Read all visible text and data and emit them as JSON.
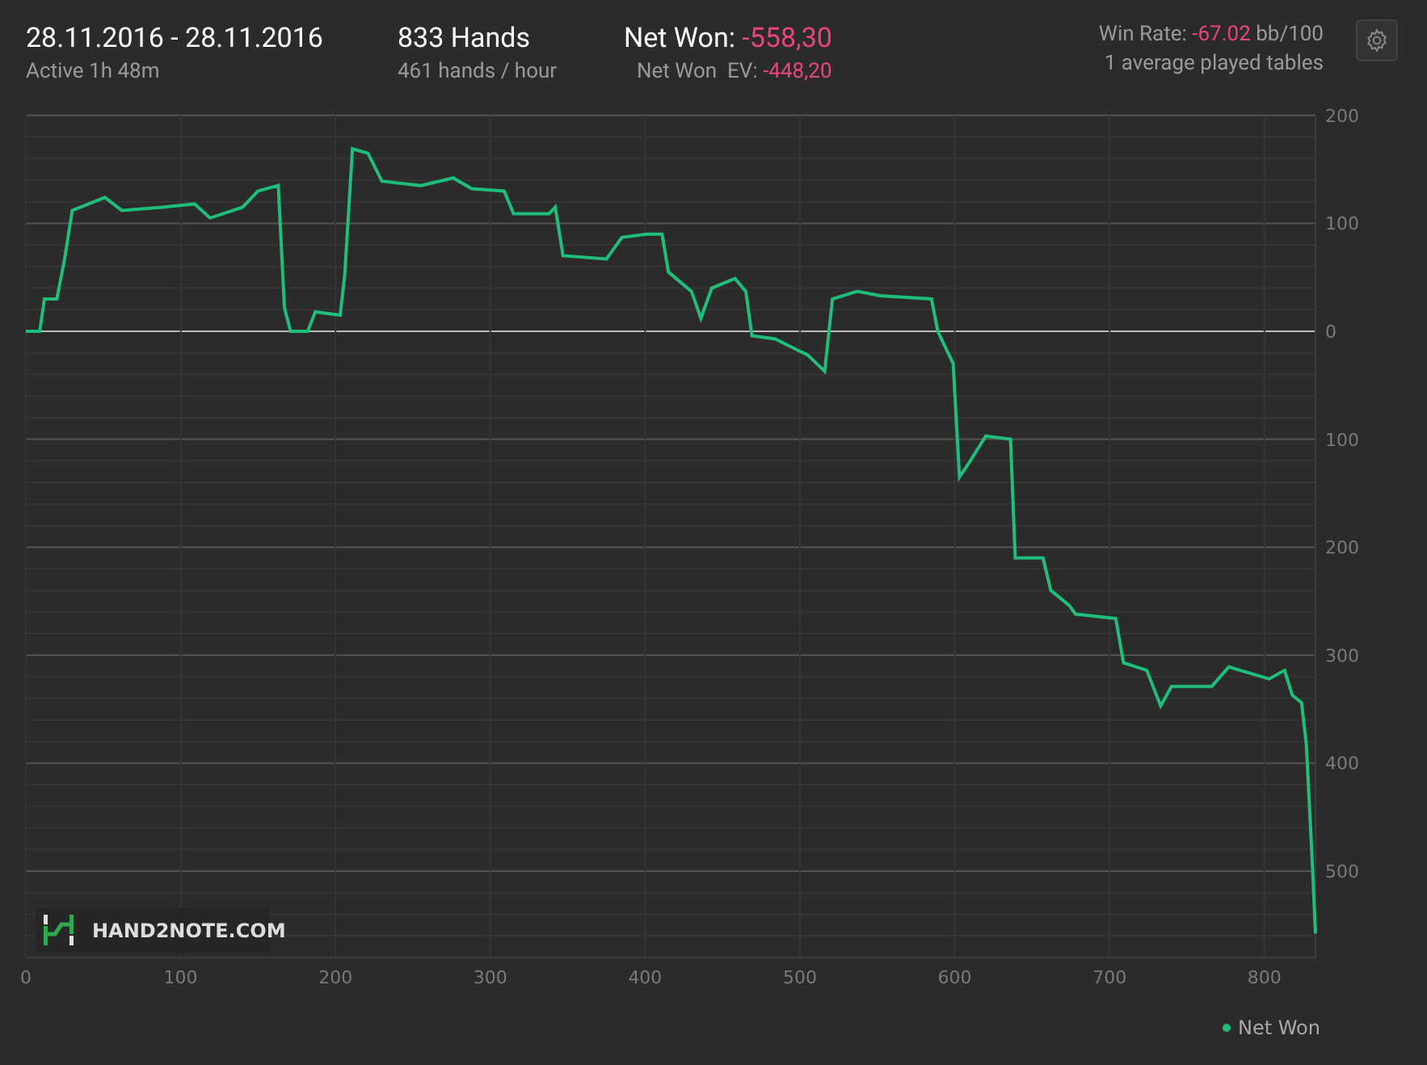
{
  "header": {
    "date_range": "28.11.2016 - 28.11.2016",
    "active": "Active 1h 48m",
    "hands": "833 Hands",
    "hands_rate": "461 hands / hour",
    "net_won": {
      "label": "Net Won:",
      "value": "-558,30"
    },
    "net_won_ev": {
      "label": "Net Won  EV:",
      "value": "-448,20"
    },
    "win_rate": {
      "label": "Win Rate:",
      "value": "-67.02",
      "unit": "bb/100"
    },
    "tables": "1 average played tables"
  },
  "chart": {
    "logo": "HAND2NOTE.COM",
    "chart_data": {
      "type": "line",
      "grid": true,
      "xlim": [
        0,
        833
      ],
      "ylim": [
        -580,
        200
      ],
      "xticks": [
        0,
        100,
        200,
        300,
        400,
        500,
        600,
        700,
        800
      ],
      "yticks": [
        {
          "value": 200,
          "label": "200"
        },
        {
          "value": 100,
          "label": "100"
        },
        {
          "value": 0,
          "label": "0"
        },
        {
          "value": -100,
          "label": "100"
        },
        {
          "value": -200,
          "label": "200"
        },
        {
          "value": -300,
          "label": "300"
        },
        {
          "value": -400,
          "label": "400"
        },
        {
          "value": -500,
          "label": "500"
        }
      ],
      "x": [
        0,
        9,
        12,
        20,
        25,
        30,
        51,
        62,
        88,
        109,
        119,
        140,
        150,
        163,
        167,
        171,
        182,
        187,
        203,
        206,
        211,
        221,
        230,
        255,
        276,
        288,
        309,
        315,
        338,
        342,
        347,
        375,
        385,
        401,
        411,
        415,
        430,
        436,
        443,
        458,
        465,
        469,
        484,
        495,
        505,
        516,
        521,
        537,
        552,
        585,
        589,
        599,
        603,
        610,
        620,
        636,
        639,
        657,
        662,
        674,
        678,
        704,
        709,
        724,
        733,
        740,
        766,
        777,
        803,
        813,
        818,
        824,
        827,
        831,
        833
      ],
      "series": [
        {
          "name": "Net Won",
          "color": "#1dbf7a",
          "values": [
            0,
            0,
            30,
            30,
            67,
            112,
            124,
            112,
            115,
            118,
            105,
            115,
            130,
            135,
            22,
            0,
            0,
            18,
            15,
            52,
            169,
            165,
            139,
            135,
            142,
            132,
            130,
            109,
            109,
            115,
            70,
            67,
            87,
            90,
            90,
            55,
            37,
            12,
            40,
            49,
            37,
            -4,
            -7,
            -15,
            -22,
            -37,
            30,
            37,
            33,
            30,
            0,
            -30,
            -135,
            -120,
            -97,
            -100,
            -210,
            -210,
            -240,
            -254,
            -262,
            -266,
            -307,
            -314,
            -347,
            -329,
            -329,
            -311,
            -322,
            -314,
            -337,
            -344,
            -382,
            -494,
            -558
          ]
        }
      ]
    }
  }
}
